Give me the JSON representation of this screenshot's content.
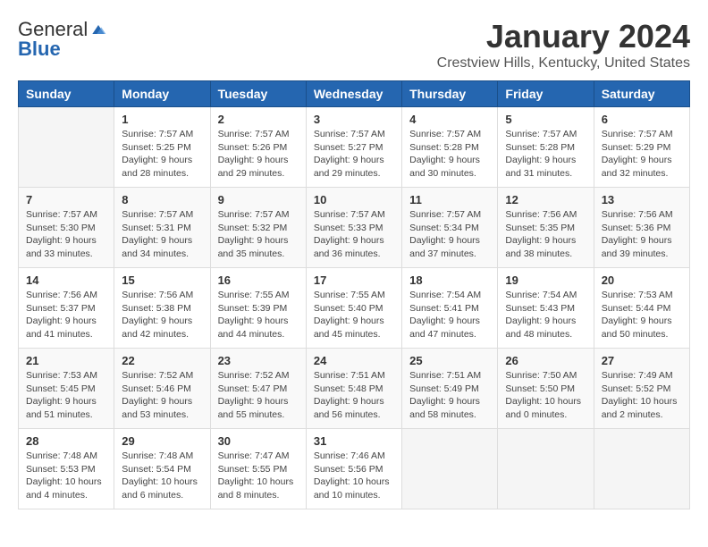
{
  "header": {
    "logo_general": "General",
    "logo_blue": "Blue",
    "month_title": "January 2024",
    "location": "Crestview Hills, Kentucky, United States"
  },
  "days_of_week": [
    "Sunday",
    "Monday",
    "Tuesday",
    "Wednesday",
    "Thursday",
    "Friday",
    "Saturday"
  ],
  "weeks": [
    [
      {
        "day": "",
        "sunrise": "",
        "sunset": "",
        "daylight": ""
      },
      {
        "day": "1",
        "sunrise": "Sunrise: 7:57 AM",
        "sunset": "Sunset: 5:25 PM",
        "daylight": "Daylight: 9 hours and 28 minutes."
      },
      {
        "day": "2",
        "sunrise": "Sunrise: 7:57 AM",
        "sunset": "Sunset: 5:26 PM",
        "daylight": "Daylight: 9 hours and 29 minutes."
      },
      {
        "day": "3",
        "sunrise": "Sunrise: 7:57 AM",
        "sunset": "Sunset: 5:27 PM",
        "daylight": "Daylight: 9 hours and 29 minutes."
      },
      {
        "day": "4",
        "sunrise": "Sunrise: 7:57 AM",
        "sunset": "Sunset: 5:28 PM",
        "daylight": "Daylight: 9 hours and 30 minutes."
      },
      {
        "day": "5",
        "sunrise": "Sunrise: 7:57 AM",
        "sunset": "Sunset: 5:28 PM",
        "daylight": "Daylight: 9 hours and 31 minutes."
      },
      {
        "day": "6",
        "sunrise": "Sunrise: 7:57 AM",
        "sunset": "Sunset: 5:29 PM",
        "daylight": "Daylight: 9 hours and 32 minutes."
      }
    ],
    [
      {
        "day": "7",
        "sunrise": "Sunrise: 7:57 AM",
        "sunset": "Sunset: 5:30 PM",
        "daylight": "Daylight: 9 hours and 33 minutes."
      },
      {
        "day": "8",
        "sunrise": "Sunrise: 7:57 AM",
        "sunset": "Sunset: 5:31 PM",
        "daylight": "Daylight: 9 hours and 34 minutes."
      },
      {
        "day": "9",
        "sunrise": "Sunrise: 7:57 AM",
        "sunset": "Sunset: 5:32 PM",
        "daylight": "Daylight: 9 hours and 35 minutes."
      },
      {
        "day": "10",
        "sunrise": "Sunrise: 7:57 AM",
        "sunset": "Sunset: 5:33 PM",
        "daylight": "Daylight: 9 hours and 36 minutes."
      },
      {
        "day": "11",
        "sunrise": "Sunrise: 7:57 AM",
        "sunset": "Sunset: 5:34 PM",
        "daylight": "Daylight: 9 hours and 37 minutes."
      },
      {
        "day": "12",
        "sunrise": "Sunrise: 7:56 AM",
        "sunset": "Sunset: 5:35 PM",
        "daylight": "Daylight: 9 hours and 38 minutes."
      },
      {
        "day": "13",
        "sunrise": "Sunrise: 7:56 AM",
        "sunset": "Sunset: 5:36 PM",
        "daylight": "Daylight: 9 hours and 39 minutes."
      }
    ],
    [
      {
        "day": "14",
        "sunrise": "Sunrise: 7:56 AM",
        "sunset": "Sunset: 5:37 PM",
        "daylight": "Daylight: 9 hours and 41 minutes."
      },
      {
        "day": "15",
        "sunrise": "Sunrise: 7:56 AM",
        "sunset": "Sunset: 5:38 PM",
        "daylight": "Daylight: 9 hours and 42 minutes."
      },
      {
        "day": "16",
        "sunrise": "Sunrise: 7:55 AM",
        "sunset": "Sunset: 5:39 PM",
        "daylight": "Daylight: 9 hours and 44 minutes."
      },
      {
        "day": "17",
        "sunrise": "Sunrise: 7:55 AM",
        "sunset": "Sunset: 5:40 PM",
        "daylight": "Daylight: 9 hours and 45 minutes."
      },
      {
        "day": "18",
        "sunrise": "Sunrise: 7:54 AM",
        "sunset": "Sunset: 5:41 PM",
        "daylight": "Daylight: 9 hours and 47 minutes."
      },
      {
        "day": "19",
        "sunrise": "Sunrise: 7:54 AM",
        "sunset": "Sunset: 5:43 PM",
        "daylight": "Daylight: 9 hours and 48 minutes."
      },
      {
        "day": "20",
        "sunrise": "Sunrise: 7:53 AM",
        "sunset": "Sunset: 5:44 PM",
        "daylight": "Daylight: 9 hours and 50 minutes."
      }
    ],
    [
      {
        "day": "21",
        "sunrise": "Sunrise: 7:53 AM",
        "sunset": "Sunset: 5:45 PM",
        "daylight": "Daylight: 9 hours and 51 minutes."
      },
      {
        "day": "22",
        "sunrise": "Sunrise: 7:52 AM",
        "sunset": "Sunset: 5:46 PM",
        "daylight": "Daylight: 9 hours and 53 minutes."
      },
      {
        "day": "23",
        "sunrise": "Sunrise: 7:52 AM",
        "sunset": "Sunset: 5:47 PM",
        "daylight": "Daylight: 9 hours and 55 minutes."
      },
      {
        "day": "24",
        "sunrise": "Sunrise: 7:51 AM",
        "sunset": "Sunset: 5:48 PM",
        "daylight": "Daylight: 9 hours and 56 minutes."
      },
      {
        "day": "25",
        "sunrise": "Sunrise: 7:51 AM",
        "sunset": "Sunset: 5:49 PM",
        "daylight": "Daylight: 9 hours and 58 minutes."
      },
      {
        "day": "26",
        "sunrise": "Sunrise: 7:50 AM",
        "sunset": "Sunset: 5:50 PM",
        "daylight": "Daylight: 10 hours and 0 minutes."
      },
      {
        "day": "27",
        "sunrise": "Sunrise: 7:49 AM",
        "sunset": "Sunset: 5:52 PM",
        "daylight": "Daylight: 10 hours and 2 minutes."
      }
    ],
    [
      {
        "day": "28",
        "sunrise": "Sunrise: 7:48 AM",
        "sunset": "Sunset: 5:53 PM",
        "daylight": "Daylight: 10 hours and 4 minutes."
      },
      {
        "day": "29",
        "sunrise": "Sunrise: 7:48 AM",
        "sunset": "Sunset: 5:54 PM",
        "daylight": "Daylight: 10 hours and 6 minutes."
      },
      {
        "day": "30",
        "sunrise": "Sunrise: 7:47 AM",
        "sunset": "Sunset: 5:55 PM",
        "daylight": "Daylight: 10 hours and 8 minutes."
      },
      {
        "day": "31",
        "sunrise": "Sunrise: 7:46 AM",
        "sunset": "Sunset: 5:56 PM",
        "daylight": "Daylight: 10 hours and 10 minutes."
      },
      {
        "day": "",
        "sunrise": "",
        "sunset": "",
        "daylight": ""
      },
      {
        "day": "",
        "sunrise": "",
        "sunset": "",
        "daylight": ""
      },
      {
        "day": "",
        "sunrise": "",
        "sunset": "",
        "daylight": ""
      }
    ]
  ]
}
